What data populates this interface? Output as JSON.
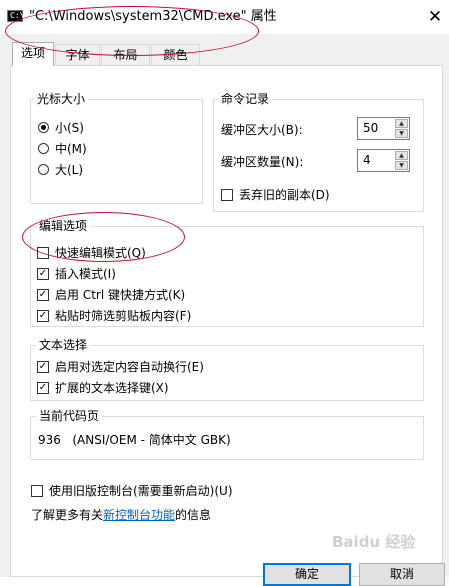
{
  "window": {
    "title": "\"C:\\Windows\\system32\\CMD.exe\" 属性",
    "icon_text": "C:\\",
    "close_glyph": "✕"
  },
  "tabs": [
    {
      "label": "选项",
      "active": true
    },
    {
      "label": "字体",
      "active": false
    },
    {
      "label": "布局",
      "active": false
    },
    {
      "label": "颜色",
      "active": false
    }
  ],
  "cursor_size": {
    "legend": "光标大小",
    "options": [
      {
        "label": "小(S)",
        "checked": true
      },
      {
        "label": "中(M)",
        "checked": false
      },
      {
        "label": "大(L)",
        "checked": false
      }
    ]
  },
  "command_history": {
    "legend": "命令记录",
    "buffer_size_label": "缓冲区大小(B):",
    "buffer_size_value": "50",
    "buffer_count_label": "缓冲区数量(N):",
    "buffer_count_value": "4",
    "discard_old_label": "丢弃旧的副本(D)",
    "discard_old_checked": false
  },
  "edit_options": {
    "legend": "编辑选项",
    "items": [
      {
        "label": "快速编辑模式(Q)",
        "checked": false
      },
      {
        "label": "插入模式(I)",
        "checked": true
      },
      {
        "label": "启用 Ctrl 键快捷方式(K)",
        "checked": true
      },
      {
        "label": "粘贴时筛选剪贴板内容(F)",
        "checked": true
      }
    ]
  },
  "text_selection": {
    "legend": "文本选择",
    "items": [
      {
        "label": "启用对选定内容自动换行(E)",
        "checked": true
      },
      {
        "label": "扩展的文本选择键(X)",
        "checked": true
      }
    ]
  },
  "code_page": {
    "legend": "当前代码页",
    "value": "936   (ANSI/OEM - 简体中文 GBK)"
  },
  "legacy_console": {
    "label": "使用旧版控制台(需要重新启动)(U)",
    "checked": false
  },
  "learn_more": {
    "prefix": "了解更多有关",
    "link": "新控制台功能",
    "suffix": "的信息"
  },
  "buttons": {
    "ok": "确定",
    "cancel": "取消"
  },
  "watermark": "Baidu 经验",
  "check_glyph": "✓",
  "spin_up_glyph": "▲",
  "spin_down_glyph": "▼",
  "colors": {
    "annotation": "#c8102e",
    "link": "#0066cc",
    "accent": "#0078d7"
  }
}
